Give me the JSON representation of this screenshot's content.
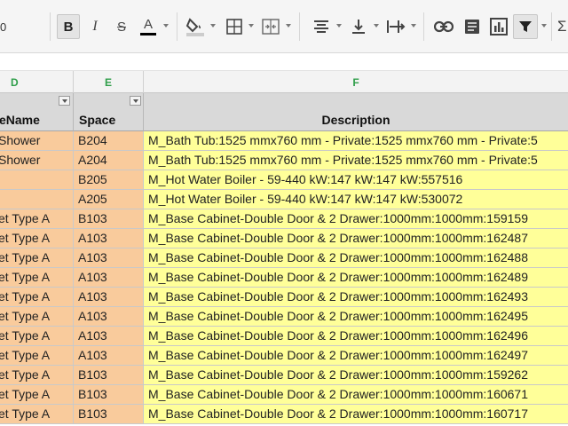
{
  "toolbar": {
    "zoom_label": "0",
    "bold_label": "B",
    "italic_label": "I",
    "strike_label": "S",
    "text_color_label": "A",
    "text_color": "#000000"
  },
  "columns": [
    "D",
    "E",
    "F"
  ],
  "headers": {
    "d": "eName",
    "e": "Space",
    "f": "Description"
  },
  "rows": [
    {
      "d": "Shower",
      "e": "B204",
      "f": "M_Bath Tub:1525 mmx760 mm - Private:1525 mmx760 mm - Private:5"
    },
    {
      "d": "Shower",
      "e": "A204",
      "f": "M_Bath Tub:1525 mmx760 mm - Private:1525 mmx760 mm - Private:5"
    },
    {
      "d": "",
      "e": "B205",
      "f": "M_Hot Water Boiler - 59-440 kW:147 kW:147 kW:557516"
    },
    {
      "d": "",
      "e": "A205",
      "f": "M_Hot Water Boiler - 59-440 kW:147 kW:147 kW:530072"
    },
    {
      "d": "et Type A",
      "e": "B103",
      "f": "M_Base Cabinet-Double Door & 2 Drawer:1000mm:1000mm:159159"
    },
    {
      "d": "et Type A",
      "e": "A103",
      "f": "M_Base Cabinet-Double Door & 2 Drawer:1000mm:1000mm:162487"
    },
    {
      "d": "et Type A",
      "e": "A103",
      "f": "M_Base Cabinet-Double Door & 2 Drawer:1000mm:1000mm:162488"
    },
    {
      "d": "et Type A",
      "e": "A103",
      "f": "M_Base Cabinet-Double Door & 2 Drawer:1000mm:1000mm:162489"
    },
    {
      "d": "et Type A",
      "e": "A103",
      "f": "M_Base Cabinet-Double Door & 2 Drawer:1000mm:1000mm:162493"
    },
    {
      "d": "et Type A",
      "e": "A103",
      "f": "M_Base Cabinet-Double Door & 2 Drawer:1000mm:1000mm:162495"
    },
    {
      "d": "et Type A",
      "e": "A103",
      "f": "M_Base Cabinet-Double Door & 2 Drawer:1000mm:1000mm:162496"
    },
    {
      "d": "et Type A",
      "e": "A103",
      "f": "M_Base Cabinet-Double Door & 2 Drawer:1000mm:1000mm:162497"
    },
    {
      "d": "et Type A",
      "e": "B103",
      "f": "M_Base Cabinet-Double Door & 2 Drawer:1000mm:1000mm:159262"
    },
    {
      "d": "et Type A",
      "e": "B103",
      "f": "M_Base Cabinet-Double Door & 2 Drawer:1000mm:1000mm:160671"
    },
    {
      "d": "et Type A",
      "e": "B103",
      "f": "M_Base Cabinet-Double Door & 2 Drawer:1000mm:1000mm:160717"
    }
  ],
  "colors": {
    "orange_cells": "#f9cb9c",
    "yellow_cells": "#ffff99",
    "header_cells": "#d9d9d9",
    "column_letter": "#2f9e4a"
  }
}
